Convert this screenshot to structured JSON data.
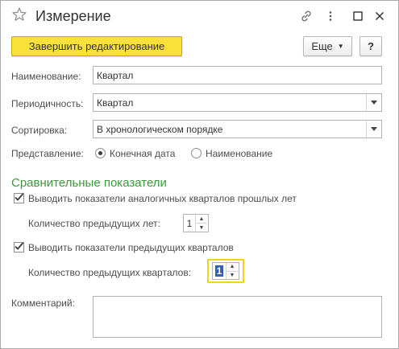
{
  "window": {
    "title": "Измерение",
    "icons": [
      "star-icon",
      "link-icon",
      "more-vertical-icon",
      "maximize-icon",
      "close-icon"
    ]
  },
  "toolbar": {
    "finish_label": "Завершить редактирование",
    "more_label": "Еще",
    "help_label": "?"
  },
  "form": {
    "name_label": "Наименование:",
    "name_value": "Квартал",
    "periodicity_label": "Периодичность:",
    "periodicity_value": "Квартал",
    "sort_label": "Сортировка:",
    "sort_value": "В хронологическом порядке",
    "repr_label": "Представление:",
    "repr_options": [
      {
        "label": "Конечная дата",
        "selected": true
      },
      {
        "label": "Наименование",
        "selected": false
      }
    ],
    "section_title": "Сравнительные показатели",
    "check1_label": "Выводить показатели аналогичных кварталов прошлых лет",
    "check1_checked": true,
    "count1_label": "Количество предыдущих лет:",
    "count1_value": "1",
    "check2_label": "Выводить показатели предыдущих кварталов",
    "check2_checked": true,
    "count2_label": "Количество предыдущих кварталов:",
    "count2_value": "1",
    "comment_label": "Комментарий:",
    "comment_value": ""
  },
  "colors": {
    "primary_button": "#fbe139",
    "section_title": "#3a9a3a",
    "focus": "#f5d21e"
  }
}
